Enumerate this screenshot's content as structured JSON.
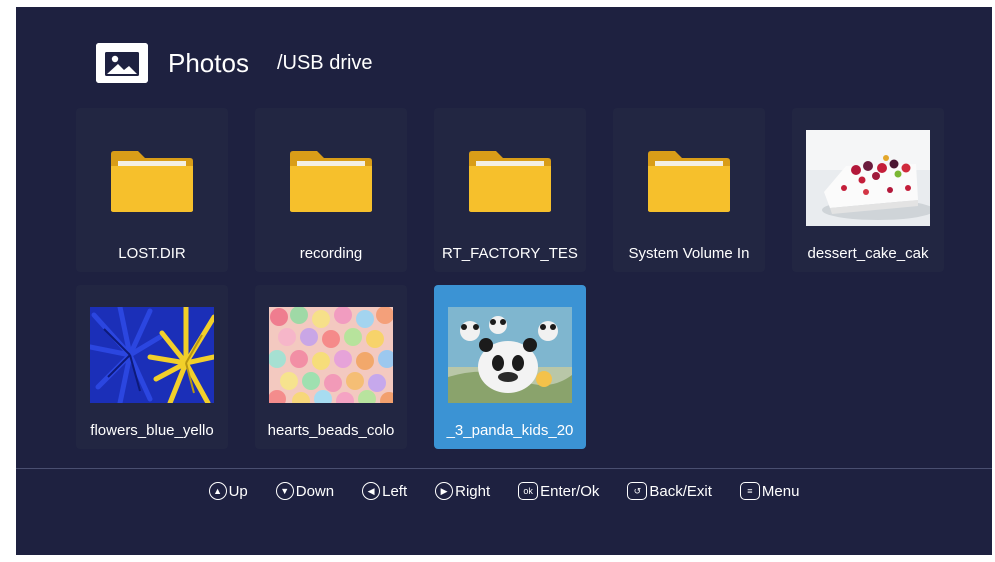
{
  "header": {
    "title": "Photos",
    "path": "/USB drive",
    "icon": "photo-icon"
  },
  "items": [
    {
      "label": "LOST.DIR",
      "type": "folder"
    },
    {
      "label": "recording",
      "type": "folder"
    },
    {
      "label": "RT_FACTORY_TES",
      "type": "folder"
    },
    {
      "label": "System Volume In",
      "type": "folder"
    },
    {
      "label": "dessert_cake_cak",
      "type": "image"
    },
    {
      "label": "flowers_blue_yello",
      "type": "image"
    },
    {
      "label": "hearts_beads_colo",
      "type": "image"
    },
    {
      "label": "_3_panda_kids_20",
      "type": "image",
      "selected": true
    }
  ],
  "controls": [
    {
      "icon": "up-icon",
      "label": "Up"
    },
    {
      "icon": "down-icon",
      "label": "Down"
    },
    {
      "icon": "left-icon",
      "label": "Left"
    },
    {
      "icon": "right-icon",
      "label": "Right"
    },
    {
      "icon": "ok-icon",
      "label": "Enter/Ok",
      "glyph": "ok"
    },
    {
      "icon": "back-icon",
      "label": "Back/Exit"
    },
    {
      "icon": "menu-icon",
      "label": "Menu"
    }
  ],
  "colors": {
    "background": "#1e2140",
    "tile": "#222642",
    "selected": "#3b93d4",
    "folder": "#f6c02c"
  }
}
